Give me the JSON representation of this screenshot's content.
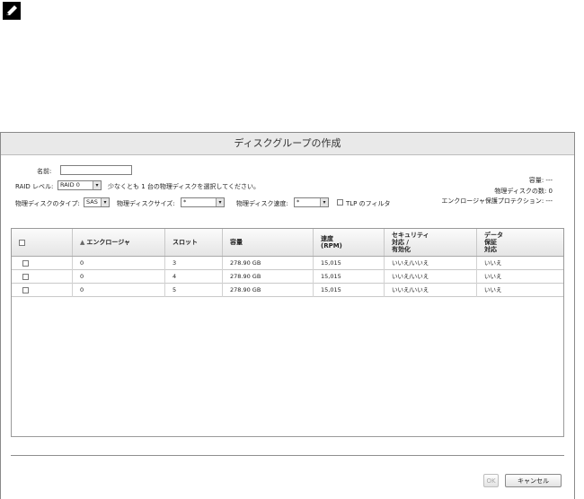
{
  "dialog": {
    "title": "ディスクグループの作成"
  },
  "form": {
    "name_label": "名前:",
    "name_value": "",
    "raid_label": "RAID レベル:",
    "raid_value": "RAID 0",
    "raid_hint": "少なくとも 1 台の物理ディスクを選択してください。",
    "disk_type_label": "物理ディスクのタイプ:",
    "disk_type_value": "SAS",
    "disk_size_label": "物理ディスクサイズ:",
    "disk_size_value": "*",
    "disk_speed_label": "物理ディスク速度:",
    "disk_speed_value": "*",
    "tlp_filter_label": "TLP のフィルタ"
  },
  "summary": {
    "capacity_label": "容量:",
    "capacity_value": "---",
    "disk_count_label": "物理ディスクの数:",
    "disk_count_value": "0",
    "enclosure_protection_label": "エンクロージャ保護プロテクション:",
    "enclosure_protection_value": "---"
  },
  "table": {
    "sort_indicator": "▲",
    "headers": {
      "enclosure": "エンクロージャ",
      "slot": "スロット",
      "capacity": "容量",
      "speed": "速度\n(RPM)",
      "security": "セキュリティ\n対応 /\n有効化",
      "data_assurance": "データ\n保証\n対応"
    },
    "rows": [
      {
        "enclosure": "0",
        "slot": "3",
        "capacity": "278.90 GB",
        "speed": "15,015",
        "security": "いいえ/いいえ",
        "data_assurance": "いいえ"
      },
      {
        "enclosure": "0",
        "slot": "4",
        "capacity": "278.90 GB",
        "speed": "15,015",
        "security": "いいえ/いいえ",
        "data_assurance": "いいえ"
      },
      {
        "enclosure": "0",
        "slot": "5",
        "capacity": "278.90 GB",
        "speed": "15,015",
        "security": "いいえ/いいえ",
        "data_assurance": "いいえ"
      }
    ]
  },
  "buttons": {
    "ok": "OK",
    "cancel": "キャンセル"
  },
  "icons": {
    "note": "pencil-note-icon"
  }
}
